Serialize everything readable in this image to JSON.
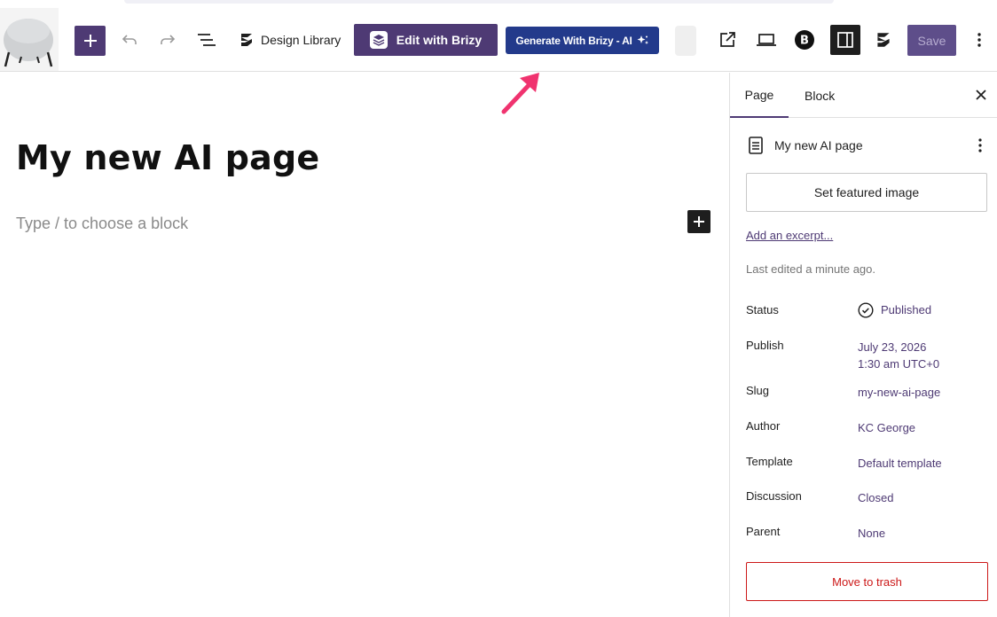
{
  "toolbar": {
    "design_library_label": "Design Library",
    "edit_with_brizy_label": "Edit with Brizy",
    "generate_ai_label": "Generate With Brizy - AI",
    "save_label": "Save"
  },
  "editor": {
    "page_title": "My new AI page",
    "block_placeholder": "Type / to choose a block"
  },
  "sidebar": {
    "tabs": [
      {
        "label": "Page"
      },
      {
        "label": "Block"
      }
    ],
    "document_title": "My new AI page",
    "featured_image_label": "Set featured image",
    "excerpt_link": "Add an excerpt...",
    "last_edited": "Last edited a minute ago.",
    "meta": {
      "status": {
        "label": "Status",
        "value": "Published"
      },
      "publish": {
        "label": "Publish",
        "date": "July 23, 2026",
        "time": "1:30 am UTC+0"
      },
      "slug": {
        "label": "Slug",
        "value": "my-new-ai-page"
      },
      "author": {
        "label": "Author",
        "value": "KC George"
      },
      "template": {
        "label": "Template",
        "value": "Default template"
      },
      "discussion": {
        "label": "Discussion",
        "value": "Closed"
      },
      "parent": {
        "label": "Parent",
        "value": "None"
      }
    },
    "trash_label": "Move to trash"
  },
  "colors": {
    "brand_purple": "#4e3a74",
    "ai_blue": "#233a8b",
    "trash_red": "#cc1818",
    "annotation_pink": "#f0336f"
  },
  "icons": [
    "plus-icon",
    "undo-icon",
    "redo-icon",
    "list-view-icon",
    "brizy-logo-icon",
    "brizy-layers-icon",
    "sparkles-icon",
    "external-link-icon",
    "laptop-icon",
    "b-circle-icon",
    "sidebar-toggle-icon",
    "kebab-menu-icon",
    "close-icon",
    "document-icon",
    "check-circle-icon"
  ]
}
